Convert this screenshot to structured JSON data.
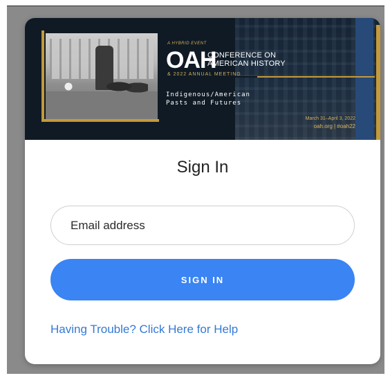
{
  "banner": {
    "tagline": "A HYBRID EVENT",
    "org": "OAH",
    "conference_line1": "CONFERENCE ON",
    "conference_line2": "AMERICAN HISTORY",
    "annual_meeting": "& 2022 ANNUAL MEETING",
    "theme_line1": "Indigenous/American",
    "theme_line2": "Pasts and Futures",
    "dates": "March 31–April 3, 2022",
    "site": "oah.org | #oah22"
  },
  "form": {
    "title": "Sign In",
    "email_placeholder": "Email address",
    "signin_label": "SIGN IN",
    "help_link": "Having Trouble? Click Here for Help"
  },
  "colors": {
    "accent": "#3a84f3",
    "link": "#3479d6",
    "banner_bg": "#0f1a24",
    "banner_gold": "#c59a3a"
  }
}
